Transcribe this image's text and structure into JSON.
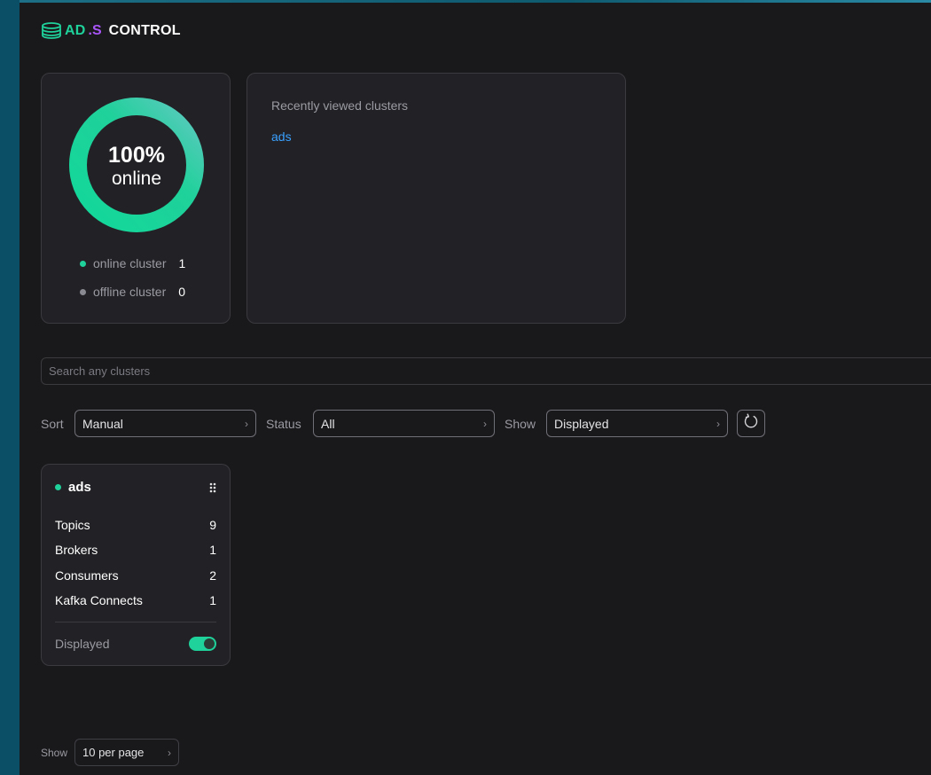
{
  "brand": {
    "logo_icon": "database-stack-icon",
    "name_ad": "AD",
    "name_s": ".S",
    "name_control": "CONTROL",
    "color_ad": "#1fd19a",
    "color_s": "#a855f7"
  },
  "status_summary": {
    "online_percent": 100,
    "percent_label": "100%",
    "percent_caption": "online",
    "online_label": "online cluster",
    "online_count": "1",
    "offline_label": "offline cluster",
    "offline_count": "0",
    "online_color": "#1fd19a",
    "offline_color": "#8a8a92"
  },
  "recent": {
    "title": "Recently viewed clusters",
    "items": [
      "ads"
    ]
  },
  "search": {
    "placeholder": "Search any clusters",
    "value": ""
  },
  "filters": {
    "sort_label": "Sort",
    "sort_value": "Manual",
    "status_label": "Status",
    "status_value": "All",
    "show_label": "Show",
    "show_value": "Displayed",
    "refresh_icon": "refresh-icon"
  },
  "clusters": [
    {
      "name": "ads",
      "status": "online",
      "stats": [
        {
          "label": "Topics",
          "value": "9"
        },
        {
          "label": "Brokers",
          "value": "1"
        },
        {
          "label": "Consumers",
          "value": "2"
        },
        {
          "label": "Kafka Connects",
          "value": "1"
        }
      ],
      "displayed_label": "Displayed",
      "displayed": true
    }
  ],
  "pagination": {
    "show_label": "Show",
    "per_page_value": "10 per page"
  }
}
